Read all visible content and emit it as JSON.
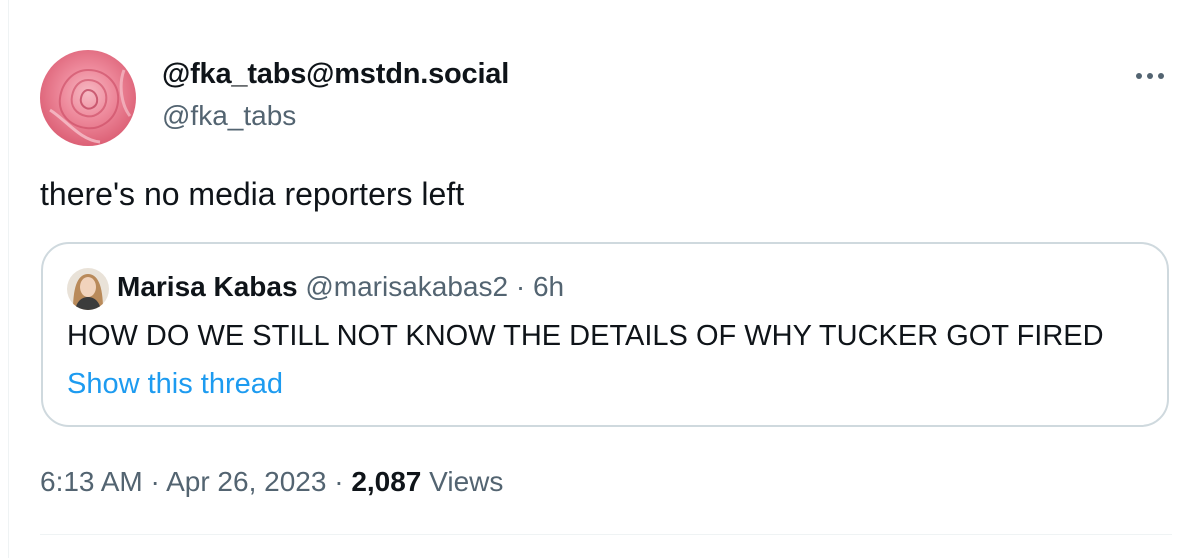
{
  "tweet": {
    "author": {
      "display_name": "@fka_tabs@mstdn.social",
      "handle": "@fka_tabs",
      "avatar_icon": "rose-avatar"
    },
    "more_icon": "more-dots-icon",
    "text": "there's no media reporters left",
    "quote": {
      "author_name": "Marisa Kabas",
      "author_handle": "@marisakabas2",
      "separator": "·",
      "time_ago": "6h",
      "avatar_icon": "person-avatar",
      "text": "HOW DO WE STILL NOT KNOW THE DETAILS OF WHY TUCKER GOT FIRED",
      "show_thread_label": "Show this thread"
    },
    "meta": {
      "time": "6:13 AM",
      "sep1": "·",
      "date": "Apr 26, 2023",
      "sep2": "·",
      "views_count": "2,087",
      "views_label": "Views"
    }
  },
  "colors": {
    "primary_text": "#0f1419",
    "secondary_text": "#536471",
    "link": "#1d9bf0",
    "border": "#cfd9de"
  }
}
